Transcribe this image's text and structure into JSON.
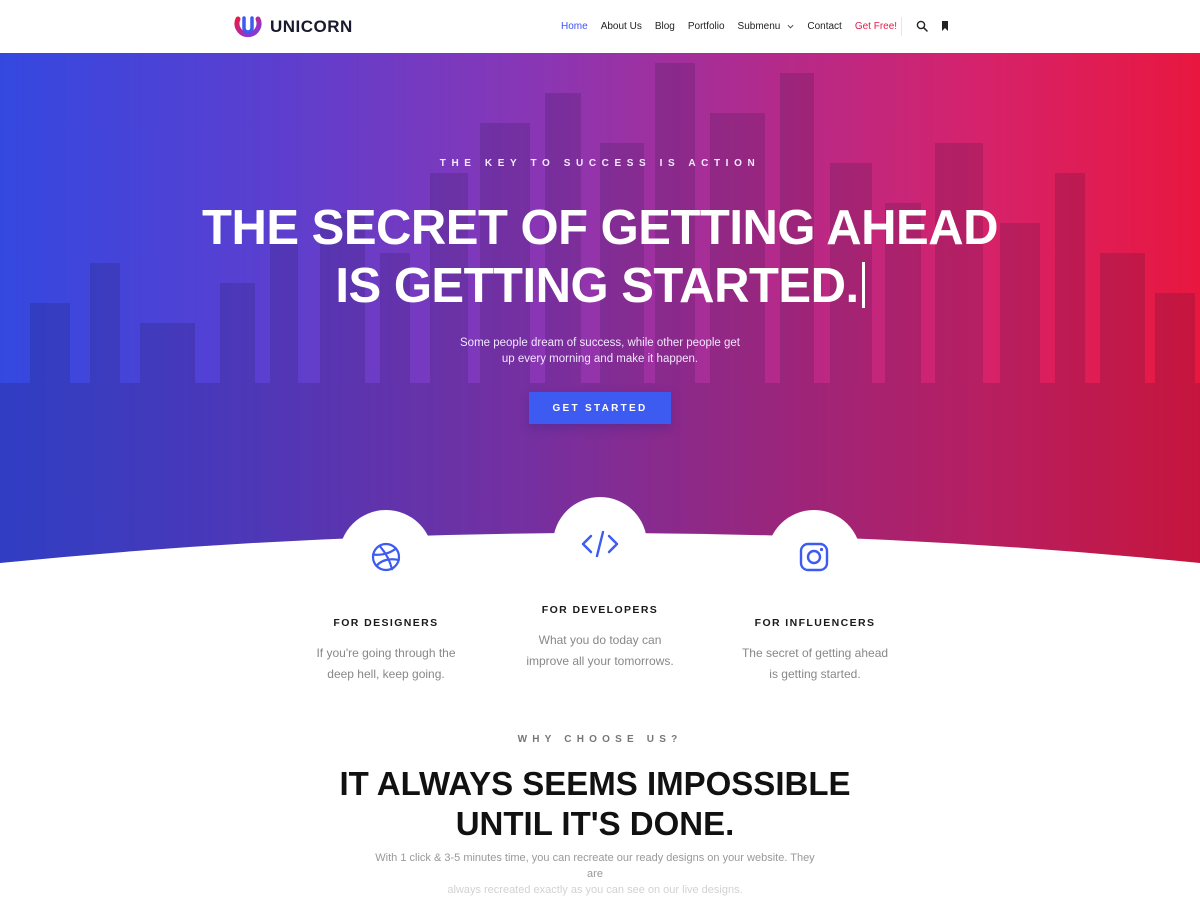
{
  "header": {
    "brand": "UNICORN",
    "nav": [
      {
        "label": "Home",
        "active": true
      },
      {
        "label": "About Us"
      },
      {
        "label": "Blog"
      },
      {
        "label": "Portfolio"
      },
      {
        "label": "Submenu",
        "has_dropdown": true
      },
      {
        "label": "Contact"
      },
      {
        "label": "Get Free!",
        "highlight": true
      }
    ],
    "icons": [
      "search-icon",
      "bookmark-icon"
    ]
  },
  "hero": {
    "kicker": "THE KEY TO SUCCESS IS ACTION",
    "title_line1": "THE SECRET OF GETTING AHEAD",
    "title_line2": "IS GETTING STARTED.",
    "subtitle_line1": "Some people dream of success, while other people get",
    "subtitle_line2": "up every morning and make it happen.",
    "button_label": "GET STARTED"
  },
  "features": [
    {
      "icon": "dribbble-icon",
      "title": "FOR DESIGNERS",
      "text_line1": "If you're going through the",
      "text_line2": "deep hell, keep going."
    },
    {
      "icon": "code-icon",
      "title": "FOR DEVELOPERS",
      "text_line1": "What you do today can",
      "text_line2": "improve all your tomorrows."
    },
    {
      "icon": "instagram-icon",
      "title": "FOR INFLUENCERS",
      "text_line1": "The secret of getting ahead",
      "text_line2": "is getting started."
    }
  ],
  "why": {
    "kicker": "WHY CHOOSE US?",
    "title_line1": "IT ALWAYS SEEMS IMPOSSIBLE",
    "title_line2": "UNTIL IT'S DONE.",
    "text_line1": "With 1 click & 3-5 minutes time, you can recreate our ready designs on your website. They are",
    "text_line2": "always recreated exactly as you can see on our live designs."
  },
  "colors": {
    "accent_blue": "#3d5af1",
    "accent_red": "#e8194a",
    "gradient_start": "#3448e0",
    "gradient_end": "#e8173f"
  }
}
